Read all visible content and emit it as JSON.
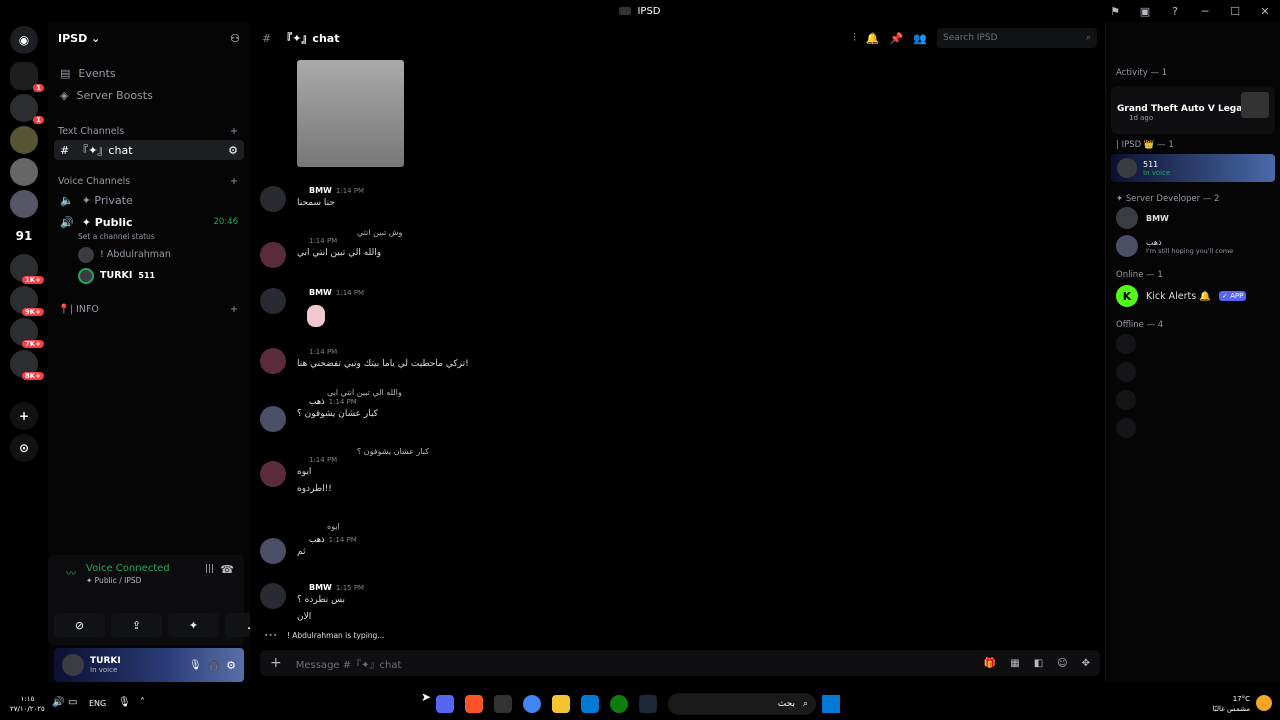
{
  "window": {
    "title": "IPSD"
  },
  "server": {
    "name": "IPSD",
    "chevron": "chevron-down-icon"
  },
  "sidebar": {
    "items": [
      {
        "label": "Events"
      },
      {
        "label": "Server Boosts"
      }
    ],
    "text_category": "Text Channels",
    "text_channel": "『✦』chat",
    "voice_category": "Voice Channels",
    "private_channel": "✦ Private",
    "public_channel": "✦ Public",
    "public_timer": "20:46",
    "channel_status": "Set a channel status",
    "voice_users": [
      {
        "name": "! Abdulrahman"
      },
      {
        "name": "TURKI",
        "tag": "511"
      }
    ],
    "info_category": "📍| INFO"
  },
  "guild_badges": [
    "1",
    "1",
    "1K+",
    "9K+",
    "7K+",
    "8K+"
  ],
  "guild_number": "91",
  "voice": {
    "status": "Voice Connected",
    "location": "✦ Public / IPSD"
  },
  "user": {
    "name": "TURKI",
    "status": "In voice"
  },
  "chat": {
    "header_channel": "『✦』chat",
    "search_placeholder": "Search IPSD",
    "messages": [
      {
        "author": "BMW",
        "time": "1:14 PM",
        "text": "حنا سمحنا"
      },
      {
        "reply": "وش تبين انتي",
        "author": "ذهب",
        "time": "1:14 PM",
        "text": "والله الي تبين انتي ابي"
      },
      {
        "author": "BMW",
        "time": "1:14 PM",
        "text": ""
      },
      {
        "author": "",
        "time": "1:14 PM",
        "text": "تركي ماحطيت لي ياما بيتك وتبي تفضحني هنا!"
      },
      {
        "reply": "والله الي تبين انتي ابي",
        "author": "ذهب",
        "time": "1:14 PM",
        "text": "كبار عشان يشوفون ؟"
      },
      {
        "reply": "كبار عشان يشوفون ؟",
        "author": "ذهب",
        "time": "1:14 PM",
        "text": "ايوه",
        "text2": "اطردوه!!"
      },
      {
        "reply": "ايوه",
        "author": "ذهب",
        "time": "1:14 PM",
        "text": "ثم"
      },
      {
        "author": "BMW",
        "time": "1:15 PM",
        "text": "بس نطرده ؟",
        "text2": "الان"
      }
    ],
    "typing": "! Abdulrahman is typing...",
    "composer_placeholder": "Message #『✦』chat"
  },
  "members": {
    "activity_header": "Activity — 1",
    "activity_game": "Grand Theft Auto V Legacy",
    "activity_time": "1d ago",
    "role1_header": "| IPSD 👑 — 1",
    "role1_member": "511",
    "role1_status": "In voice",
    "dev_header": "✦ Server Developer — 2",
    "dev_members": [
      {
        "name": "BMW"
      },
      {
        "name": "ذهب",
        "status": "I'm still hoping you'll come"
      }
    ],
    "online_header": "Online — 1",
    "bot_name": "Kick Alerts 🔔",
    "bot_badge": "✓ APP",
    "offline_header": "Offline — 4"
  },
  "taskbar": {
    "time": "١:١٥",
    "date": "٢٧/١٠/٢٠٢٥",
    "lang": "ENG",
    "search": "بحث",
    "weather_temp": "17°C",
    "weather_desc": "مشمس غالبًا"
  },
  "colors": {
    "accent": "#5865f2",
    "online": "#23a55a",
    "danger": "#f23f43",
    "bot_green": "#53fc18"
  }
}
